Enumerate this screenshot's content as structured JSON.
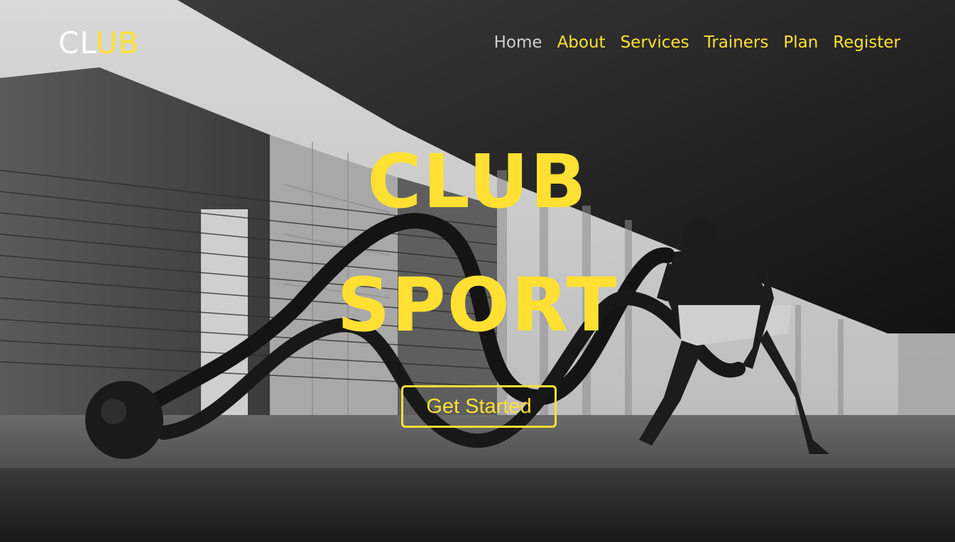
{
  "brand": {
    "part1": "CL",
    "part2": "UB"
  },
  "nav": {
    "items": [
      {
        "label": "Home",
        "active": true
      },
      {
        "label": "About"
      },
      {
        "label": "Services"
      },
      {
        "label": "Trainers"
      },
      {
        "label": "Plan"
      },
      {
        "label": "Register"
      }
    ]
  },
  "hero": {
    "line1": "CLUB",
    "line2": "SPORT",
    "cta_label": "Get Started",
    "background_image": "black-and-white-photo-athlete-battle-ropes-under-concrete-overpass"
  },
  "colors": {
    "accent": "#FFE033",
    "nav_active": "#cfcfcf",
    "brand_primary": "#ffffff"
  }
}
